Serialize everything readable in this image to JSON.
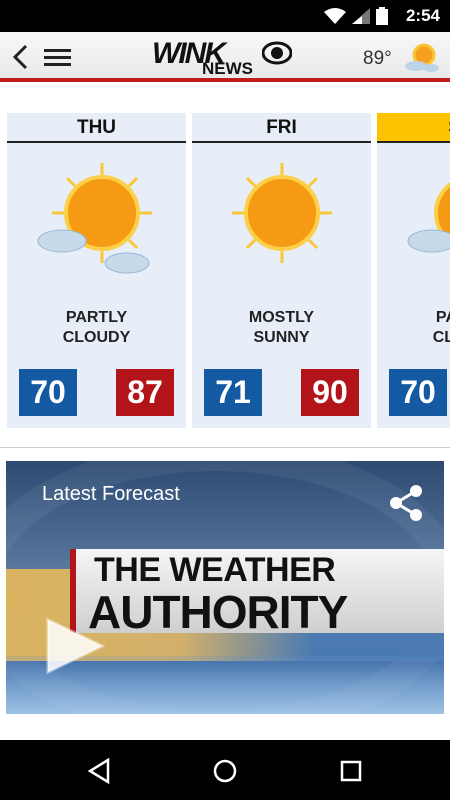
{
  "status_bar": {
    "time": "2:54"
  },
  "app_bar": {
    "logo_text_top": "WINK",
    "logo_text_bottom": "NEWS",
    "temperature": "89°",
    "weather_icon": "sun-cloud-icon"
  },
  "forecast": [
    {
      "day": "THU",
      "condition": "PARTLY\nCLOUDY",
      "low": "70",
      "high": "87",
      "icon": "partly-cloudy-icon"
    },
    {
      "day": "FRI",
      "condition": "MOSTLY\nSUNNY",
      "low": "71",
      "high": "90",
      "icon": "sunny-icon"
    },
    {
      "day": "SAT",
      "condition": "PARTLY\nCLOUDY",
      "low": "70",
      "high": "",
      "icon": "partly-cloudy-icon"
    }
  ],
  "video": {
    "caption": "Latest Forecast",
    "title_line1": "THE WEATHER",
    "title_line2": "AUTHORITY"
  },
  "colors": {
    "low_temp": "#145aa3",
    "high_temp": "#b3141a",
    "today_header": "#fdc300",
    "app_bar_accent": "#c41a1a"
  }
}
